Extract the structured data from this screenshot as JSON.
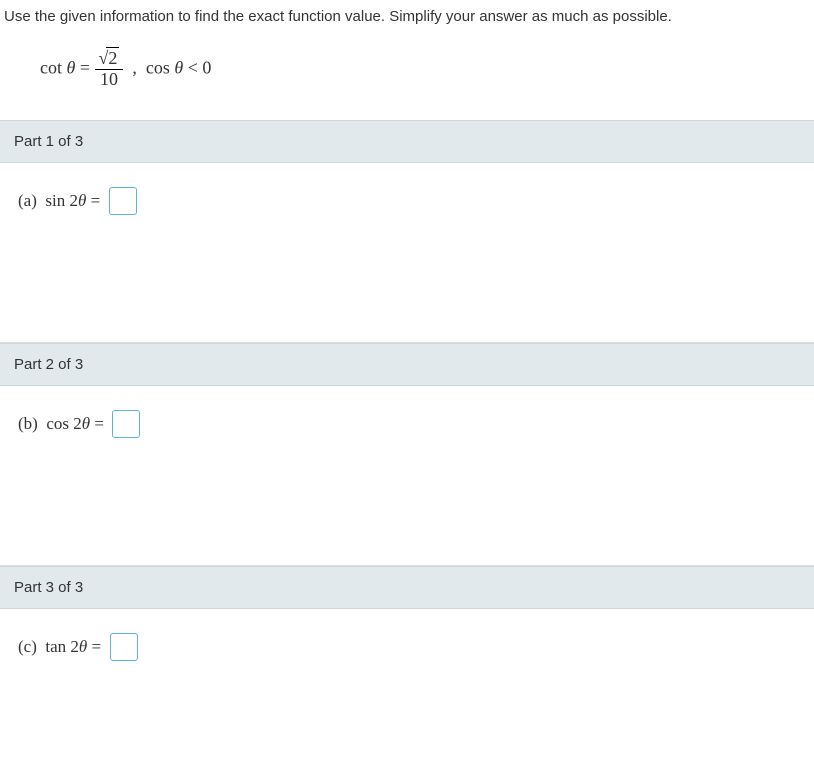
{
  "instructions": "Use the given information to find the exact function value. Simplify your answer as much as possible.",
  "given": {
    "lhs": "cot θ = ",
    "frac_num_sqrt": "2",
    "frac_den": "10",
    "condition": ",  cos θ < 0"
  },
  "parts": [
    {
      "header": "Part 1 of 3",
      "label_prefix": "(a)  sin 2θ = "
    },
    {
      "header": "Part 2 of 3",
      "label_prefix": "(b)  cos 2θ = "
    },
    {
      "header": "Part 3 of 3",
      "label_prefix": "(c)  tan 2θ = "
    }
  ]
}
